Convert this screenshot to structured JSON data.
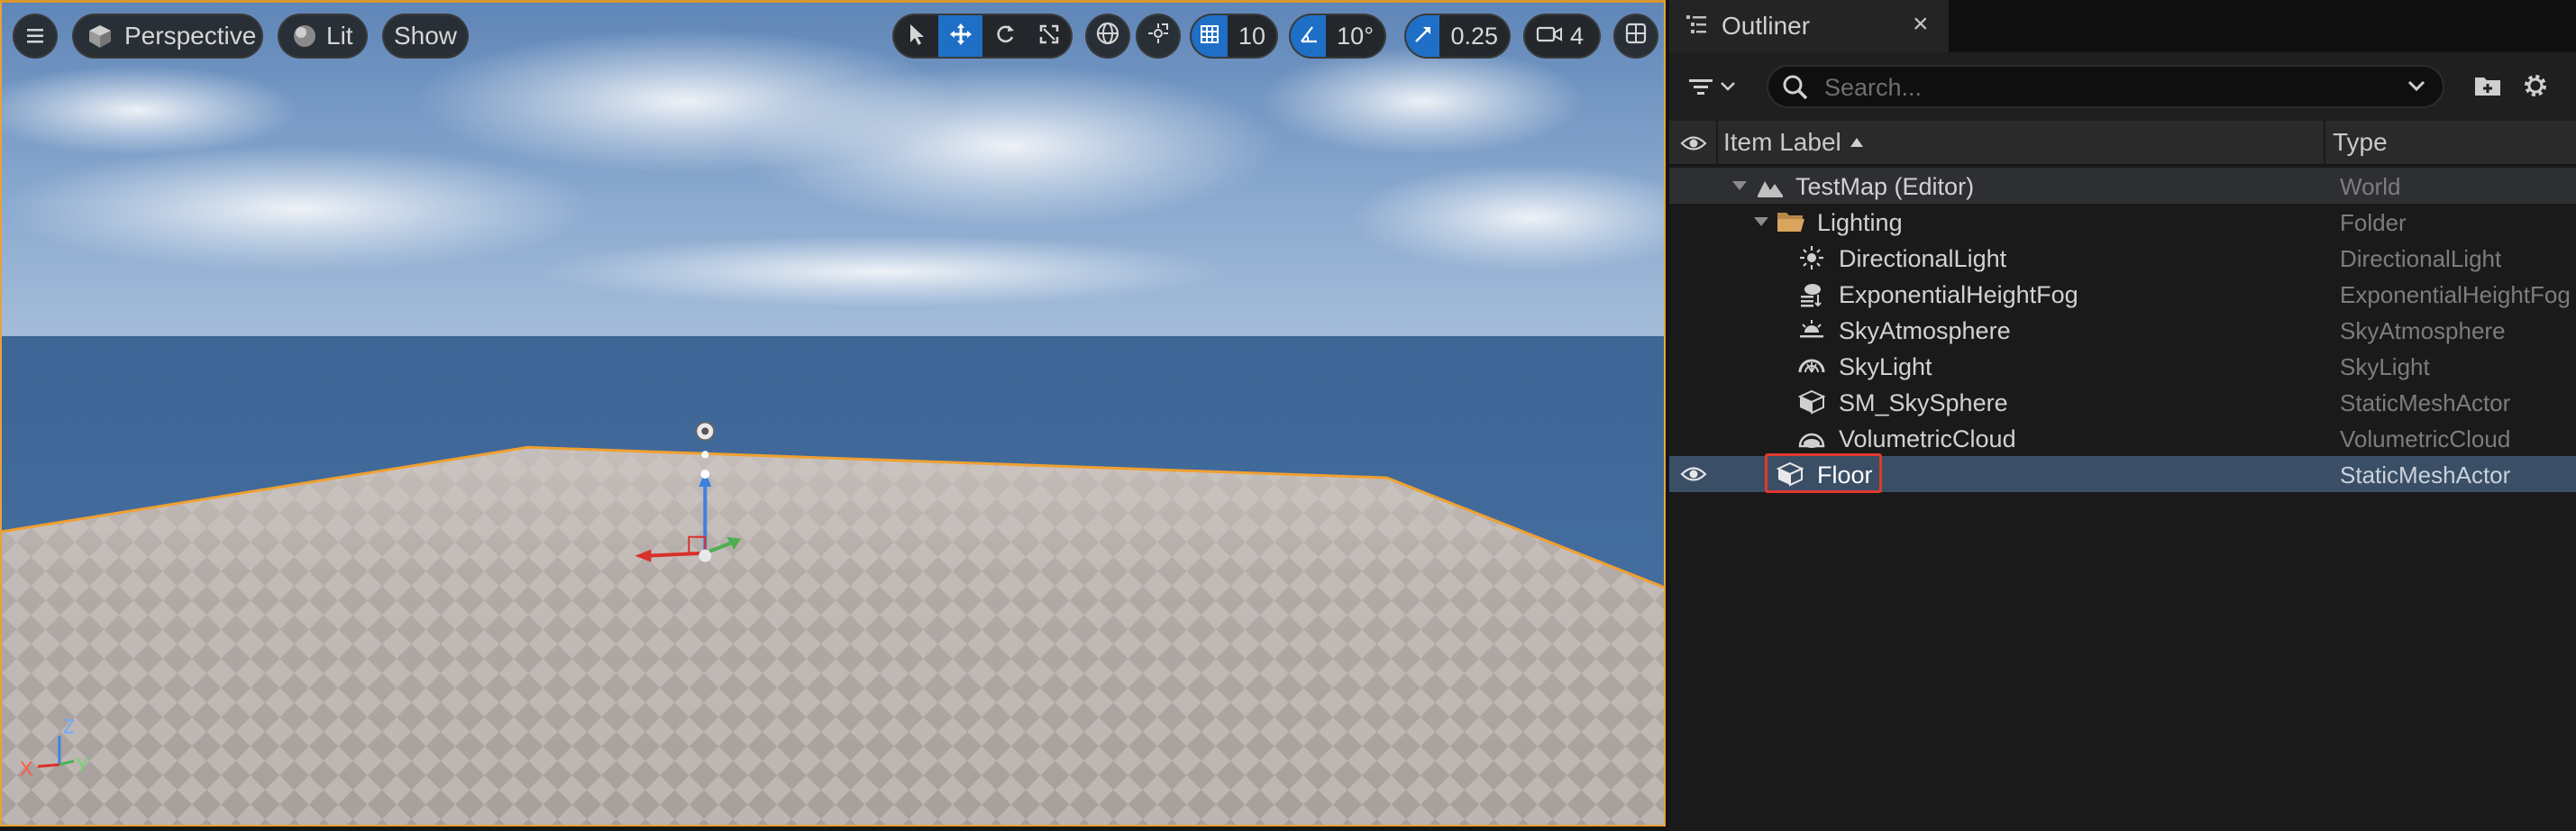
{
  "viewport": {
    "menu_icon": "hamburger-icon",
    "perspective_label": "Perspective",
    "lit_label": "Lit",
    "show_label": "Show",
    "grid_snap_value": "10",
    "rotation_snap_value": "10°",
    "scale_snap_value": "0.25",
    "camera_speed_value": "4",
    "axis": {
      "x": "X",
      "y": "Y",
      "z": "Z"
    },
    "colors": {
      "active": "#1f6fc7",
      "selection_outline": "#e8a238"
    }
  },
  "outliner": {
    "tab_title": "Outliner",
    "close_glyph": "×",
    "search_placeholder": "Search...",
    "columns": {
      "label": "Item Label",
      "type": "Type"
    },
    "items": [
      {
        "label": "TestMap (Editor)",
        "type": "World",
        "icon": "world-icon"
      },
      {
        "label": "Lighting",
        "type": "Folder",
        "icon": "folder-icon"
      },
      {
        "label": "DirectionalLight",
        "type": "DirectionalLight",
        "icon": "sun-icon"
      },
      {
        "label": "ExponentialHeightFog",
        "type": "ExponentialHeightFog",
        "icon": "fog-icon"
      },
      {
        "label": "SkyAtmosphere",
        "type": "SkyAtmosphere",
        "icon": "sky-atmosphere-icon"
      },
      {
        "label": "SkyLight",
        "type": "SkyLight",
        "icon": "skylight-icon"
      },
      {
        "label": "SM_SkySphere",
        "type": "StaticMeshActor",
        "icon": "static-mesh-icon"
      },
      {
        "label": "VolumetricCloud",
        "type": "VolumetricCloud",
        "icon": "cloud-icon"
      },
      {
        "label": "Floor",
        "type": "StaticMeshActor",
        "icon": "static-mesh-icon"
      }
    ],
    "colors": {
      "selected_row": "#3a4e66",
      "highlight": "#e0392e"
    }
  }
}
